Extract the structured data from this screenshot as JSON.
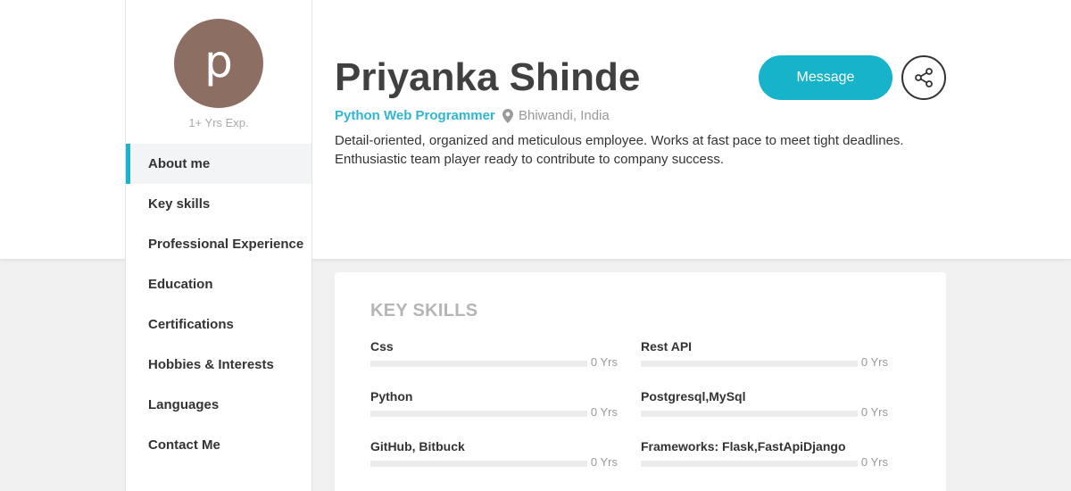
{
  "profile": {
    "avatar_letter": "p",
    "experience": "1+ Yrs Exp.",
    "name": "Priyanka Shinde",
    "role": "Python Web Programmer",
    "location": "Bhiwandi, India",
    "bio": "Detail-oriented, organized and meticulous employee. Works at fast pace to meet tight deadlines. Enthusiastic team player ready to contribute to company success."
  },
  "actions": {
    "message_label": "Message"
  },
  "sidebar": {
    "items": [
      {
        "label": "About me",
        "active": true
      },
      {
        "label": "Key skills",
        "active": false
      },
      {
        "label": "Professional Experience",
        "active": false
      },
      {
        "label": "Education",
        "active": false
      },
      {
        "label": "Certifications",
        "active": false
      },
      {
        "label": "Hobbies & Interests",
        "active": false
      },
      {
        "label": "Languages",
        "active": false
      },
      {
        "label": "Contact Me",
        "active": false
      }
    ]
  },
  "skills_section": {
    "title": "KEY SKILLS",
    "skills": [
      {
        "name": "Css",
        "years": "0 Yrs",
        "level": 0
      },
      {
        "name": "Rest API",
        "years": "0 Yrs",
        "level": 0
      },
      {
        "name": "Python",
        "years": "0 Yrs",
        "level": 0
      },
      {
        "name": "Postgresql,MySql",
        "years": "0 Yrs",
        "level": 0
      },
      {
        "name": "GitHub, Bitbuck",
        "years": "0 Yrs",
        "level": 0
      },
      {
        "name": "Frameworks: Flask,FastApiDjango",
        "years": "0 Yrs",
        "level": 0
      }
    ]
  },
  "colors": {
    "accent": "#16b3cb",
    "avatar_bg": "#8d6e63",
    "role_text": "#2fb6cf"
  },
  "icons": {
    "share": "share-icon",
    "location": "map-pin-icon"
  }
}
